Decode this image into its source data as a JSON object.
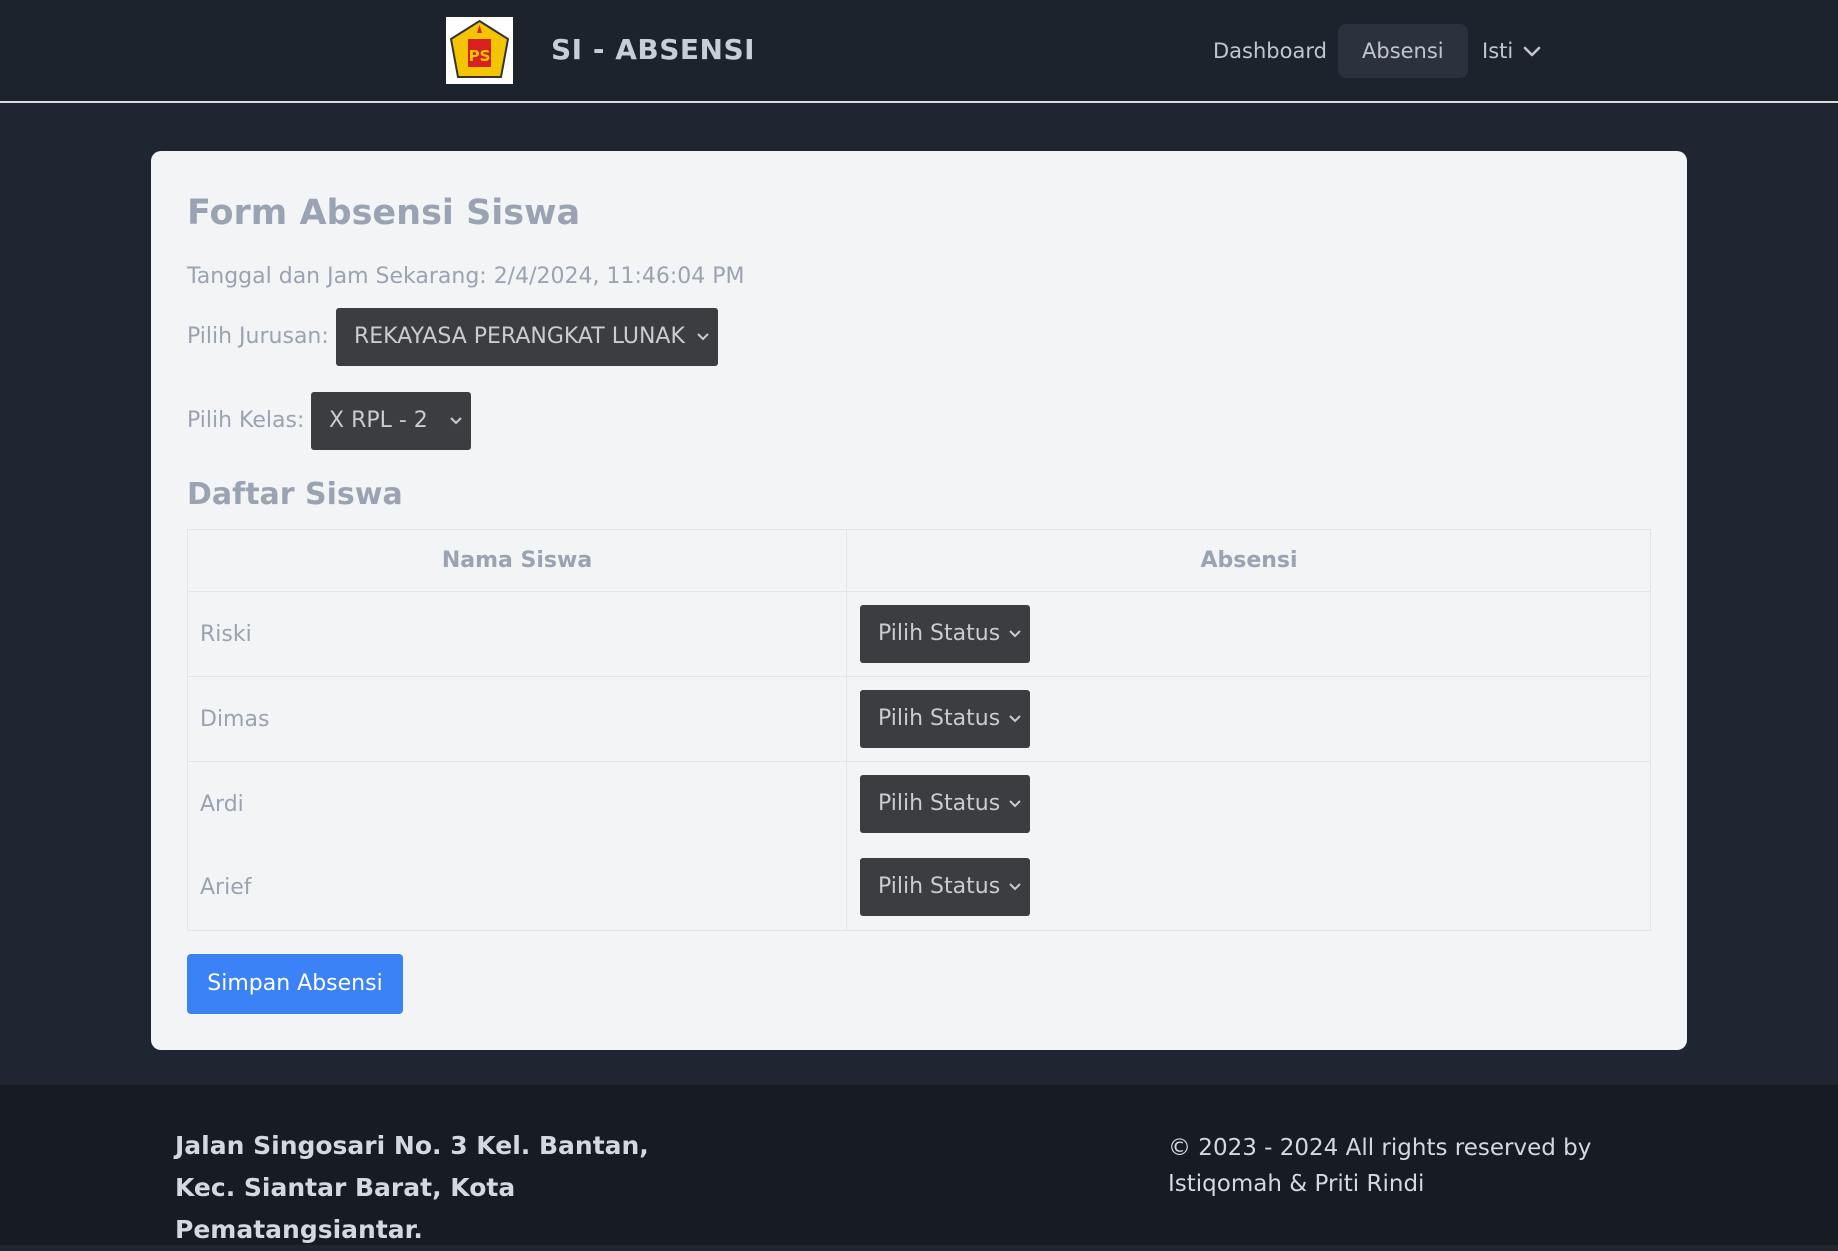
{
  "navbar": {
    "brand": "SI - ABSENSI",
    "logo_text": "PS",
    "items": [
      {
        "label": "Dashboard",
        "active": false
      },
      {
        "label": "Absensi",
        "active": true
      }
    ],
    "user_menu": {
      "label": "Isti",
      "icon": "chevron-down-icon"
    }
  },
  "form": {
    "title": "Form Absensi Siswa",
    "datetime": "Tanggal dan Jam Sekarang: 2/4/2024, 11:46:04 PM",
    "jurusan_label": "Pilih Jurusan:",
    "jurusan_value": "REKAYASA PERANGKAT LUNAK",
    "kelas_label": "Pilih Kelas:",
    "kelas_value": "X RPL - 2",
    "list_title": "Daftar Siswa",
    "table": {
      "headers": [
        "Nama Siswa",
        "Absensi"
      ],
      "rows": [
        {
          "nama": "Riski",
          "status": "Pilih Status"
        },
        {
          "nama": "Dimas",
          "status": "Pilih Status"
        },
        {
          "nama": "Ardi",
          "status": "Pilih Status"
        },
        {
          "nama": "Arief",
          "status": "Pilih Status"
        }
      ]
    },
    "save_label": "Simpan Absensi"
  },
  "footer": {
    "address": "Jalan Singosari No. 3 Kel. Bantan, Kec. Siantar Barat, Kota Pematangsiantar.",
    "copyright": "© 2023 - 2024 All rights reserved by Istiqomah & Priti Rindi"
  },
  "colors": {
    "page_bg": "#1f2631",
    "navbar_bg": "#1d232c",
    "card_bg": "#f3f4f6",
    "select_bg": "#3b3d40",
    "primary": "#3b82f6",
    "footer_bg": "#171b22"
  }
}
